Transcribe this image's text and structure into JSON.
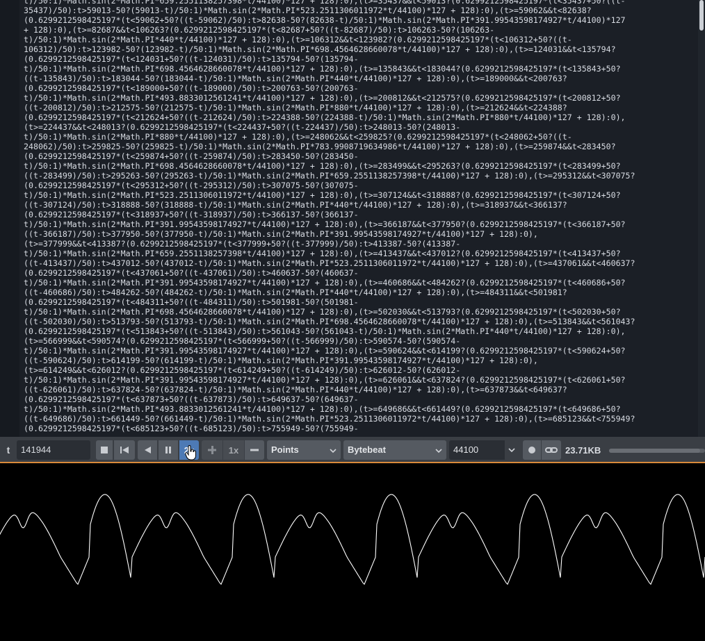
{
  "editor": {
    "code_lines": [
      "t)/50:1)*Math.sin(2*Math.PI*659.2551138257398*t/44100)*127 + 128):0),(t>=35437&&t<59013?(0.6299212598425197*(t<35437+50?((t-",
      "35437)/50):t>59013-50?(59013-t)/50:1)*Math.sin(2*Math.PI*523.2511306011972*t/44100)*127 + 128):0),(t>=59062&&t<82638?",
      "(0.6299212598425197*(t<59062+50?((t-59062)/50):t>82638-50?(82638-t)/50:1)*Math.sin(2*Math.PI*391.99543598174927*t/44100)*127",
      "+ 128):0),(t>=82687&&t<106263?(0.6299212598425197*(t<82687+50?((t-82687)/50):t>106263-50?(106263-",
      "t)/50:1)*Math.sin(2*Math.PI*440*t/44100)*127 + 128):0),(t>=106312&&t<123982?(0.6299212598425197*(t<106312+50?((t-",
      "106312)/50):t>123982-50?(123982-t)/50:1)*Math.sin(2*Math.PI*698.4564628660078*t/44100)*127 + 128):0),(t>=124031&&t<135794?",
      "(0.6299212598425197*(t<124031+50?((t-124031)/50):t>135794-50?(135794-",
      "t)/50:1)*Math.sin(2*Math.PI*698.4564628660078*t/44100)*127 + 128):0),(t>=135843&&t<183044?(0.6299212598425197*(t<135843+50?",
      "((t-135843)/50):t>183044-50?(183044-t)/50:1)*Math.sin(2*Math.PI*440*t/44100)*127 + 128):0),(t>=189000&&t<200763?",
      "(0.6299212598425197*(t<189000+50?((t-189000)/50):t>200763-50?(200763-",
      "t)/50:1)*Math.sin(2*Math.PI*493.8833012561241*t/44100)*127 + 128):0),(t>=200812&&t<212575?(0.6299212598425197*(t<200812+50?",
      "((t-200812)/50):t>212575-50?(212575-t)/50:1)*Math.sin(2*Math.PI*880*t/44100)*127 + 128):0),(t>=212624&&t<224388?",
      "(0.6299212598425197*(t<212624+50?((t-212624)/50):t>224388-50?(224388-t)/50:1)*Math.sin(2*Math.PI*880*t/44100)*127 + 128):0),",
      "(t>=224437&&t<248013?(0.6299212598425197*(t<224437+50?((t-224437)/50):t>248013-50?(248013-",
      "t)/50:1)*Math.sin(2*Math.PI*880*t/44100)*127 + 128):0),(t>=248062&&t<259825?(0.6299212598425197*(t<248062+50?((t-",
      "248062)/50):t>259825-50?(259825-t)/50:1)*Math.sin(2*Math.PI*783.9908719634986*t/44100)*127 + 128):0),(t>=259874&&t<283450?",
      "(0.6299212598425197*(t<259874+50?((t-259874)/50):t>283450-50?(283450-",
      "t)/50:1)*Math.sin(2*Math.PI*698.4564628660078*t/44100)*127 + 128):0),(t>=283499&&t<295263?(0.6299212598425197*(t<283499+50?",
      "((t-283499)/50):t>295263-50?(295263-t)/50:1)*Math.sin(2*Math.PI*659.2551138257398*t/44100)*127 + 128):0),(t>=295312&&t<307075?",
      "(0.6299212598425197*(t<295312+50?((t-295312)/50):t>307075-50?(307075-",
      "t)/50:1)*Math.sin(2*Math.PI*523.2511306011972*t/44100)*127 + 128):0),(t>=307124&&t<318888?(0.6299212598425197*(t<307124+50?",
      "((t-307124)/50):t>318888-50?(318888-t)/50:1)*Math.sin(2*Math.PI*440*t/44100)*127 + 128):0),(t>=318937&&t<366137?",
      "(0.6299212598425197*(t<318937+50?((t-318937)/50):t>366137-50?(366137-",
      "t)/50:1)*Math.sin(2*Math.PI*391.99543598174927*t/44100)*127 + 128):0),(t>=366187&&t<377950?(0.6299212598425197*(t<366187+50?",
      "((t-366187)/50):t>377950-50?(377950-t)/50:1)*Math.sin(2*Math.PI*391.99543598174927*t/44100)*127 + 128):0),",
      "(t>=377999&&t<413387?(0.6299212598425197*(t<377999+50?((t-377999)/50):t>413387-50?(413387-",
      "t)/50:1)*Math.sin(2*Math.PI*659.2551138257398*t/44100)*127 + 128):0),(t>=413437&&t<437012?(0.6299212598425197*(t<413437+50?",
      "((t-413437)/50):t>437012-50?(437012-t)/50:1)*Math.sin(2*Math.PI*523.2511306011972*t/44100)*127 + 128):0),(t>=437061&&t<460637?",
      "(0.6299212598425197*(t<437061+50?((t-437061)/50):t>460637-50?(460637-",
      "t)/50:1)*Math.sin(2*Math.PI*391.99543598174927*t/44100)*127 + 128):0),(t>=460686&&t<484262?(0.6299212598425197*(t<460686+50?",
      "((t-460686)/50):t>484262-50?(484262-t)/50:1)*Math.sin(2*Math.PI*440*t/44100)*127 + 128):0),(t>=484311&&t<501981?",
      "(0.6299212598425197*(t<484311+50?((t-484311)/50):t>501981-50?(501981-",
      "t)/50:1)*Math.sin(2*Math.PI*698.4564628660078*t/44100)*127 + 128):0),(t>=502030&&t<513793?(0.6299212598425197*(t<502030+50?",
      "((t-502030)/50):t>513793-50?(513793-t)/50:1)*Math.sin(2*Math.PI*698.4564628660078*t/44100)*127 + 128):0),(t>=513843&&t<561043?",
      "(0.6299212598425197*(t<513843+50?((t-513843)/50):t>561043-50?(561043-t)/50:1)*Math.sin(2*Math.PI*440*t/44100)*127 + 128):0),",
      "(t>=566999&&t<590574?(0.6299212598425197*(t<566999+50?((t-566999)/50):t>590574-50?(590574-",
      "t)/50:1)*Math.sin(2*Math.PI*391.99543598174927*t/44100)*127 + 128):0),(t>=590624&&t<614199?(0.6299212598425197*(t<590624+50?",
      "((t-590624)/50):t>614199-50?(614199-t)/50:1)*Math.sin(2*Math.PI*391.99543598174927*t/44100)*127 + 128):0),",
      "(t>=614249&&t<626012?(0.6299212598425197*(t<614249+50?((t-614249)/50):t>626012-50?(626012-",
      "t)/50:1)*Math.sin(2*Math.PI*391.99543598174927*t/44100)*127 + 128):0),(t>=626061&&t<637824?(0.6299212598425197*(t<626061+50?",
      "((t-626061)/50):t>637824-50?(637824-t)/50:1)*Math.sin(2*Math.PI*440*t/44100)*127 + 128):0),(t>=637873&&t<649637?",
      "(0.6299212598425197*(t<637873+50?((t-637873)/50):t>649637-50?(649637-",
      "t)/50:1)*Math.sin(2*Math.PI*493.8833012561241*t/44100)*127 + 128):0),(t>=649686&&t<661449?(0.6299212598425197*(t<649686+50?",
      "((t-649686)/50):t>661449-50?(661449-t)/50:1)*Math.sin(2*Math.PI*523.2511306011972*t/44100)*127 + 128):0),(t>=685123&&t<755949?",
      "(0.6299212598425197*(t<685123+50?((t-685123)/50):t>755949-50?(755949-"
    ]
  },
  "controls": {
    "t_label": "t",
    "t_value": "141944",
    "stop_icon": "stop-icon",
    "rewind_icon": "skip-to-start-icon",
    "play_reverse_icon": "play-backward-icon",
    "pause_icon": "pause-icon",
    "speed_2x_label": "2x",
    "plus_icon": "plus-icon",
    "speed_1x_label": "1x",
    "minus_icon": "minus-icon",
    "draw_mode": "Points",
    "mode": "Bytebeat",
    "sample_rate": "44100",
    "record_icon": "record-icon",
    "link_icon": "link-icon",
    "size_label": "23.71KB",
    "volume": 0.95
  },
  "colors": {
    "accent": "#d98a3a",
    "editor_bg": "#1b1f26",
    "scope_line": "#ffffff"
  }
}
